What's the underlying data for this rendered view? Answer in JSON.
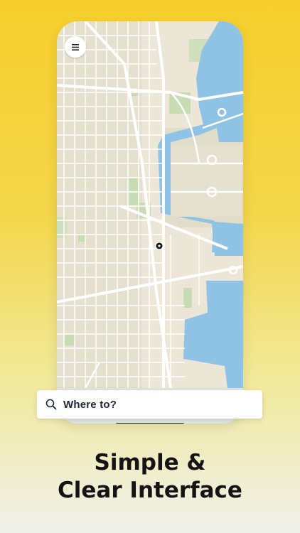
{
  "map": {
    "menu_icon": "hamburger-menu-icon",
    "location_icon": "current-location-pin-icon",
    "colors": {
      "land": "#ebe6d6",
      "road": "#ffffff",
      "water": "#8ec3e6",
      "park": "#c8dcb4"
    }
  },
  "search": {
    "icon": "search-icon",
    "label": "Where to?"
  },
  "headline": {
    "line1": "Simple &",
    "line2": "Clear Interface"
  },
  "colors": {
    "accent": "#f6cf2c",
    "text": "#141414"
  }
}
